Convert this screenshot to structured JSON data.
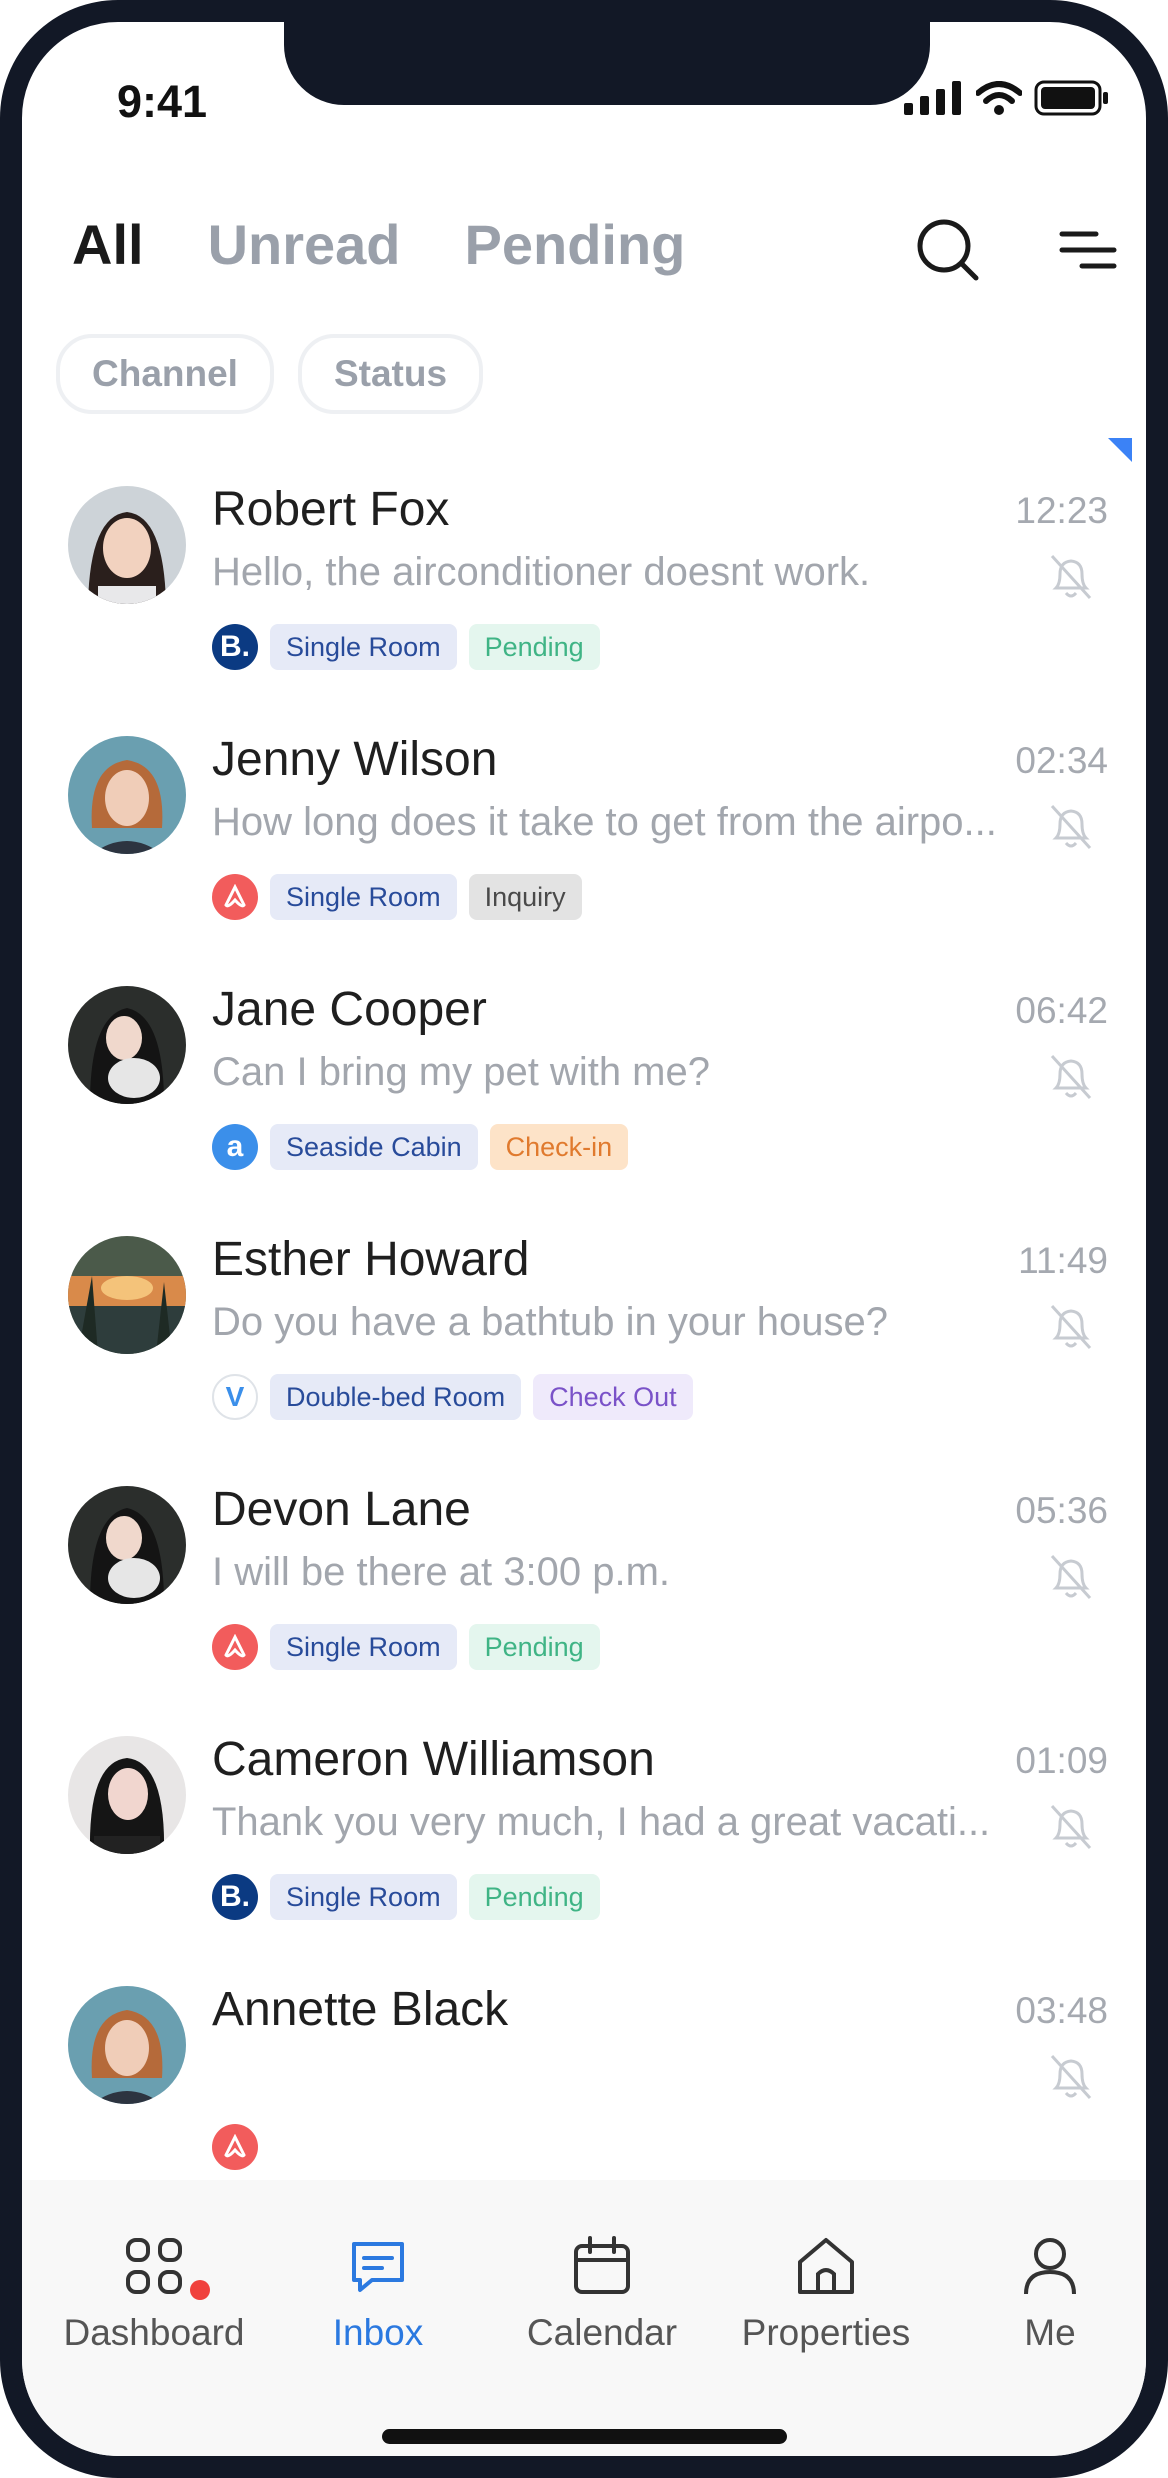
{
  "status_bar": {
    "time": "9:41"
  },
  "tabs": [
    {
      "label": "All",
      "active": true
    },
    {
      "label": "Unread",
      "active": false
    },
    {
      "label": "Pending",
      "active": false
    }
  ],
  "filters": [
    {
      "label": "Channel"
    },
    {
      "label": "Status"
    }
  ],
  "conversations": [
    {
      "name": "Robert Fox",
      "time": "12:23",
      "message": "Hello, the airconditioner doesnt work.",
      "source": "booking",
      "room": "Single Room",
      "status": "Pending",
      "status_type": "pending"
    },
    {
      "name": "Jenny Wilson",
      "time": "02:34",
      "message": "How long does it take to get from the airpo...",
      "source": "airbnb",
      "room": "Single Room",
      "status": "Inquiry",
      "status_type": "inquiry"
    },
    {
      "name": "Jane Cooper",
      "time": "06:42",
      "message": "Can I bring my pet with me?",
      "source": "agoda",
      "room": "Seaside Cabin",
      "status": "Check-in",
      "status_type": "checkin"
    },
    {
      "name": "Esther Howard",
      "time": "11:49",
      "message": "Do you have a bathtub in your house?",
      "source": "vrbo",
      "room": "Double-bed Room",
      "status": "Check Out",
      "status_type": "checkout"
    },
    {
      "name": "Devon Lane",
      "time": "05:36",
      "message": "I will be there at 3:00 p.m.",
      "source": "airbnb",
      "room": "Single Room",
      "status": "Pending",
      "status_type": "pending"
    },
    {
      "name": "Cameron Williamson",
      "time": "01:09",
      "message": "Thank you very much, I had a great vacati...",
      "source": "booking",
      "room": "Single Room",
      "status": "Pending",
      "status_type": "pending"
    },
    {
      "name": "Annette Black",
      "time": "03:48",
      "message": "",
      "source": "airbnb",
      "room": "",
      "status": "",
      "status_type": ""
    }
  ],
  "tabbar": [
    {
      "label": "Dashboard",
      "icon": "dashboard-icon",
      "badge": true
    },
    {
      "label": "Inbox",
      "icon": "inbox-icon",
      "active": true
    },
    {
      "label": "Calendar",
      "icon": "calendar-icon"
    },
    {
      "label": "Properties",
      "icon": "home-icon"
    },
    {
      "label": "Me",
      "icon": "person-icon"
    }
  ],
  "colors": {
    "accent": "#2b79e0",
    "badge": "#f0413d",
    "frame": "#121826"
  }
}
